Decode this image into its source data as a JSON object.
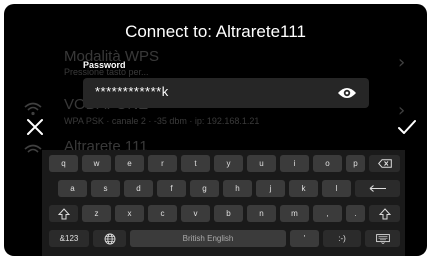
{
  "dialog": {
    "title": "Connect to: Altrarete111",
    "password_label": "Password",
    "password_value": "************k"
  },
  "background_list": [
    {
      "name": "Modalità WPS",
      "detail": "Pressione tasto per..."
    },
    {
      "name": "VODAFONE",
      "detail": "WPA PSK · canale 2 · -35 dbm · ip: 192.168.1.21"
    },
    {
      "name": "Altrarete 111",
      "detail": ""
    }
  ],
  "keyboard": {
    "row1": [
      "q",
      "w",
      "e",
      "r",
      "t",
      "y",
      "u",
      "i",
      "o",
      "p"
    ],
    "row2": [
      "a",
      "s",
      "d",
      "f",
      "g",
      "h",
      "j",
      "k",
      "l"
    ],
    "row3": [
      "z",
      "x",
      "c",
      "v",
      "b",
      "n",
      "m",
      ",",
      "."
    ],
    "numbers_key": "&123",
    "space_label": "British English",
    "apostrophe_key": "'",
    "emoji_key": ":-)"
  },
  "icons": {
    "cancel": "close-icon",
    "confirm": "checkmark-icon",
    "visibility": "eye-icon",
    "backspace": "backspace-icon",
    "enter": "enter-icon",
    "shift": "shift-icon",
    "language": "globe-icon",
    "hide_keyboard": "keyboard-icon",
    "wifi": "wifi-icon",
    "chevron": "chevron-right-icon"
  }
}
